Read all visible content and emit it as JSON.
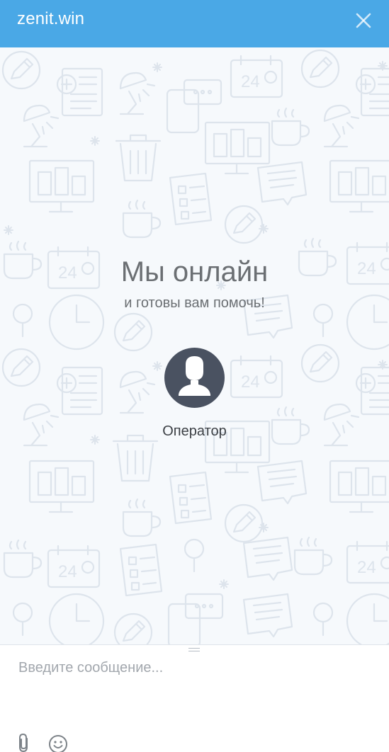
{
  "header": {
    "title": "zenit.win",
    "close_icon": "close-icon"
  },
  "welcome": {
    "title": "Мы онлайн",
    "subtitle": "и готовы вам помочь!"
  },
  "operator": {
    "name": "Оператор",
    "avatar_icon": "user-silhouette-icon"
  },
  "composer": {
    "placeholder": "Введите сообщение...",
    "attach_icon": "paperclip-icon",
    "emoji_icon": "smiley-icon"
  },
  "colors": {
    "header_bg": "#4aa8e6",
    "chat_bg": "#f6f9fc",
    "avatar_bg": "#4a5261",
    "pattern_stroke": "#dde4ec"
  }
}
